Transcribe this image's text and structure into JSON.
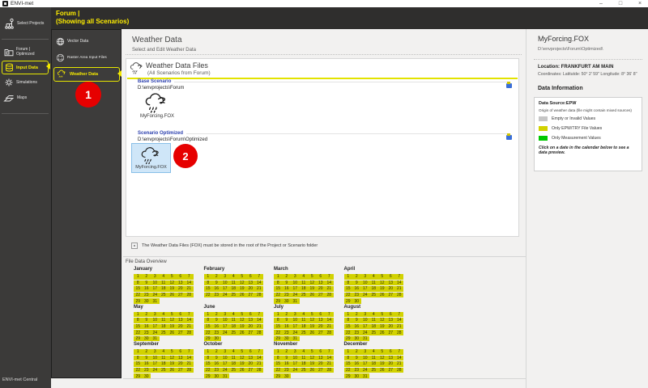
{
  "window": {
    "title": "ENVI-met",
    "controls": {
      "minimize": "–",
      "maximize": "□",
      "close": "×"
    },
    "status_bar": "ENVI-met Central"
  },
  "header": {
    "line1": "Forum |",
    "line2": "(Showing all Scenarios)"
  },
  "sidebar": {
    "items": [
      {
        "label": "Select Projects"
      },
      {
        "label1": "Forum |",
        "label2": "Optimized"
      },
      {
        "label": "Input Data",
        "active": true
      },
      {
        "label": "Simulations"
      },
      {
        "label": "Maps"
      }
    ]
  },
  "subsidebar": {
    "items": [
      {
        "label": "Vector Data"
      },
      {
        "label": "Raster Area Input Files"
      },
      {
        "label": "Weather Data",
        "active": true
      }
    ]
  },
  "annotations": {
    "step1": "1",
    "step2": "2"
  },
  "main": {
    "title": "Weather Data",
    "subtitle": "Select and Edit Weather Data",
    "panel": {
      "header": "Weather Data Files",
      "subheader": "(All Scenarios from Forum)",
      "sections": [
        {
          "label": "Base Scenario",
          "path": "D:\\envprojects\\Forum",
          "file": "MyForcing.FOX",
          "selected": false
        },
        {
          "label": "Scenario Optimized",
          "path": "D:\\envprojects\\Forum\\Optimized",
          "file": "MyForcing.FOX",
          "selected": true
        }
      ]
    },
    "note": "The Weather Data Files (FOX) must be stored in the root of the Project or Scenario folder",
    "calendar": {
      "title": "File Data Overview",
      "months": [
        {
          "name": "January",
          "days": 31
        },
        {
          "name": "February",
          "days": 28
        },
        {
          "name": "March",
          "days": 31
        },
        {
          "name": "April",
          "days": 30
        },
        {
          "name": "May",
          "days": 31
        },
        {
          "name": "June",
          "days": 30
        },
        {
          "name": "July",
          "days": 31
        },
        {
          "name": "August",
          "days": 31
        },
        {
          "name": "September",
          "days": 30
        },
        {
          "name": "October",
          "days": 31
        },
        {
          "name": "November",
          "days": 30
        },
        {
          "name": "December",
          "days": 31
        }
      ],
      "all_days_status": "epw"
    }
  },
  "details": {
    "title": "MyForcing.FOX",
    "path": "D:\\envprojects\\Forum\\Optimized\\",
    "location": "Location: FRANKFURT AM MAIN",
    "coordinates": "Coordinates: Latitutde: 50° 2' 59'' Longitude: 8° 36' 8''",
    "section_title": "Data Information",
    "data_source": "Data Source:EPW",
    "origin_note": "Origin of weather data (file might contain mixed sources)",
    "legend": [
      {
        "label": "Empty or Invalid Values",
        "color": "#c6c6c6"
      },
      {
        "label": "Only EPW/TRY File Values",
        "color": "#d2d200"
      },
      {
        "label": "Only Measurement Values",
        "color": "#00c800"
      }
    ],
    "hint": "Click on a date in the calendar below to see a data preview."
  },
  "colors": {
    "epw_day": "#d2d200",
    "accent_yellow": "#f5e900",
    "badge_red": "#e60000",
    "selection_bg": "#cfe6f8",
    "selection_border": "#88bfe8"
  }
}
